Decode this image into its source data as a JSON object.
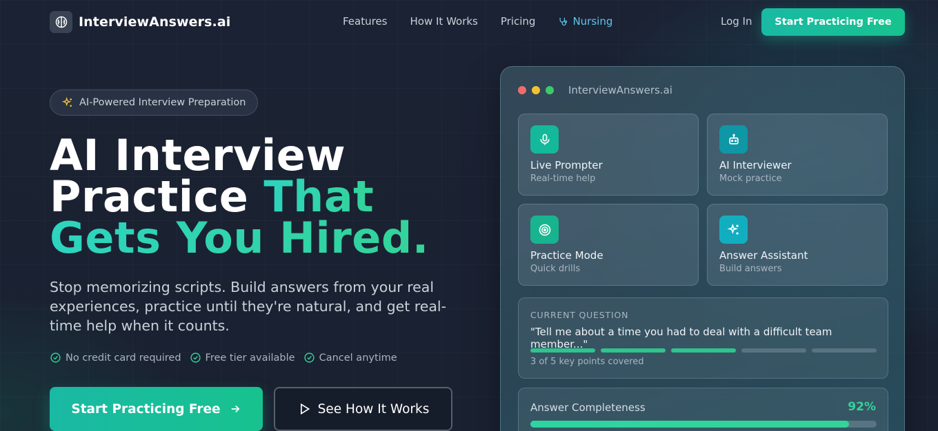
{
  "nav": {
    "brand": "InterviewAnswers.ai",
    "links": [
      "Features",
      "How It Works",
      "Pricing"
    ],
    "nursing": "Nursing",
    "login": "Log In",
    "cta": "Start Practicing Free"
  },
  "hero": {
    "badge": "AI-Powered Interview Preparation",
    "headline_line1": "AI Interview",
    "headline_line2a": "Practice ",
    "headline_line2b": "That",
    "headline_line3": "Gets You Hired.",
    "subtitle": "Stop memorizing scripts. Build answers from your real experiences, practice until they're natural, and get real-time help when it counts.",
    "checks": [
      "No credit card required",
      "Free tier available",
      "Cancel anytime"
    ],
    "primary_cta": "Start Practicing Free",
    "secondary_cta": "See How It Works"
  },
  "panel": {
    "title": "InterviewAnswers.ai",
    "cards": [
      {
        "title": "Live Prompter",
        "subtitle": "Real-time help",
        "icon": "microphone-icon",
        "color": "#14b89a"
      },
      {
        "title": "AI Interviewer",
        "subtitle": "Mock practice",
        "icon": "robot-icon",
        "color": "#0f97a6"
      },
      {
        "title": "Practice Mode",
        "subtitle": "Quick drills",
        "icon": "target-icon",
        "color": "#17b48f"
      },
      {
        "title": "Answer Assistant",
        "subtitle": "Build answers",
        "icon": "sparkles-icon",
        "color": "#12aec0"
      }
    ],
    "question": {
      "label": "CURRENT QUESTION",
      "text": "\"Tell me about a time you had to deal with a difficult team member...\"",
      "covered": 3,
      "total": 5,
      "progress_text": "3 of 5 key points covered"
    },
    "completeness": {
      "label": "Answer Completeness",
      "value": "92%",
      "fraction": 0.92
    }
  },
  "colors": {
    "accent": "#2dd4bf",
    "accent_green": "#34d399",
    "dot_red": "#f16b6b",
    "dot_yellow": "#f2c230",
    "dot_green": "#3fc86a"
  }
}
